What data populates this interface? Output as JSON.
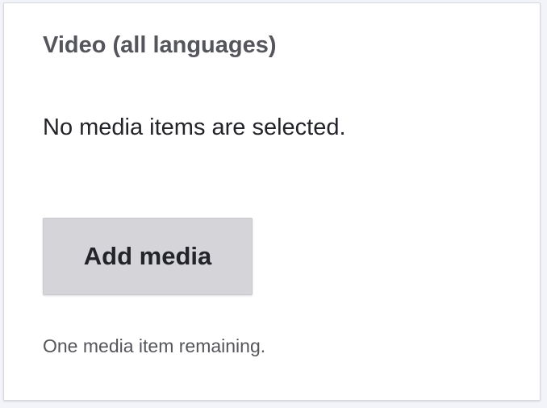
{
  "field": {
    "title": "Video (all languages)",
    "empty_message": "No media items are selected.",
    "add_button_label": "Add media",
    "remaining_text": "One media item remaining."
  }
}
